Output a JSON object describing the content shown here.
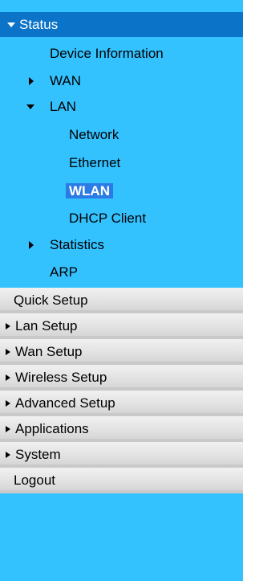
{
  "status": {
    "label": "Status",
    "items": {
      "device_information": "Device Information",
      "wan": "WAN",
      "lan": "LAN",
      "lan_children": {
        "network": "Network",
        "ethernet": "Ethernet",
        "wlan": "WLAN",
        "dhcp_client": "DHCP Client"
      },
      "statistics": "Statistics",
      "arp": "ARP"
    }
  },
  "menu": [
    {
      "label": "Quick Setup",
      "has_arrow": false
    },
    {
      "label": "Lan Setup",
      "has_arrow": true
    },
    {
      "label": "Wan Setup",
      "has_arrow": true
    },
    {
      "label": "Wireless Setup",
      "has_arrow": true
    },
    {
      "label": "Advanced Setup",
      "has_arrow": true
    },
    {
      "label": "Applications",
      "has_arrow": true
    },
    {
      "label": "System",
      "has_arrow": true
    },
    {
      "label": "Logout",
      "has_arrow": false
    }
  ],
  "colors": {
    "panel_background": "#34c2ff",
    "status_header": "#0b74c8",
    "selected_highlight": "#2b7be6",
    "menu_gradient_top": "#f1f1f1",
    "menu_gradient_bottom": "#d6d6d6"
  }
}
